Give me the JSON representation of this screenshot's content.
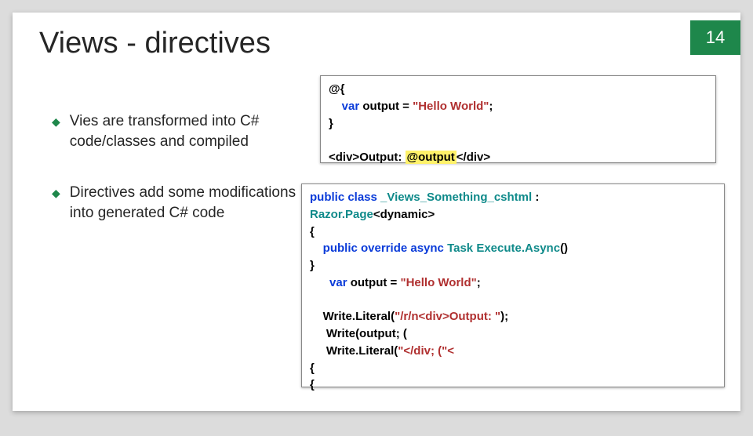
{
  "page": {
    "title": "Views - directives",
    "number": "14"
  },
  "bullets": [
    "Vies are transformed into C# code/classes and compiled",
    "Directives add some modifications into generated C# code"
  ],
  "code1": {
    "l1": "@{",
    "l2_pre": "    ",
    "l2_var": "var",
    "l2_mid": " output = ",
    "l2_str": "\"Hello World\"",
    "l2_end": ";",
    "l3": "}",
    "l4_a": "<div>",
    "l4_b": "Output: ",
    "l4_c": "@output",
    "l4_d": "</div>"
  },
  "code2": {
    "l1_a": "public class ",
    "l1_b": "_Views_Something_cshtml",
    "l1_c": " :",
    "l2_a": "Razor.Page",
    "l2_b": "<dynamic>",
    "l3": "{",
    "l4_a": "    public override async ",
    "l4_b": "Task ",
    "l4_c": "Execute.Async",
    "l4_d": "()",
    "l5": "}",
    "l6_pre": "      ",
    "l6_var": "var",
    "l6_mid": " output = ",
    "l6_str": "\"Hello World\"",
    "l6_end": ";",
    "blank": "",
    "l7_a": "    Write.Literal(",
    "l7_b": "\"/r/n<div>Output: \"",
    "l7_c": ");",
    "l8_a": "     Write(output; (",
    "l9_a": "     Write.Literal(",
    "l9_b": "\"</div; (\"<",
    "l10": "{",
    "l11": "{"
  }
}
